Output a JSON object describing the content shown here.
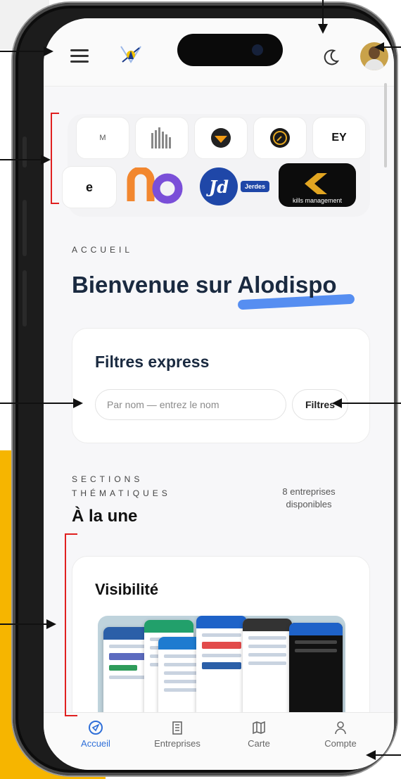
{
  "colors": {
    "accent": "#2f6fd8",
    "annotation_arrow": "#111111",
    "annotation_bracket": "#e02020",
    "highlight": "#f6b500"
  },
  "header": {
    "menu_icon": "hamburger-icon",
    "logo_icon": "app-logo-icon",
    "theme_icon": "moon-icon",
    "avatar_icon": "user-avatar"
  },
  "partners": {
    "row1": [
      "M",
      "",
      "",
      "",
      "EY"
    ],
    "row2": [
      "e",
      "",
      "Jerdes",
      "kills management"
    ],
    "row2_logo_text": "Jd"
  },
  "page": {
    "overline": "ACCUEIL",
    "title_prefix": "Bienvenue sur ",
    "title_brand": "Alodispo"
  },
  "filters": {
    "title": "Filtres express",
    "search_placeholder": "Par nom — entrez le nom",
    "button_label": "Filtres"
  },
  "sections": {
    "overline_1": "SECTIONS",
    "overline_2": "THÉMATIQUES",
    "heading": "À la une",
    "count_label": "8 entreprises disponibles",
    "card_title": "Visibilité"
  },
  "bottom_nav": [
    {
      "label": "Accueil",
      "icon": "compass-icon",
      "active": true
    },
    {
      "label": "Entreprises",
      "icon": "building-icon",
      "active": false
    },
    {
      "label": "Carte",
      "icon": "map-icon",
      "active": false
    },
    {
      "label": "Compte",
      "icon": "user-icon",
      "active": false
    }
  ]
}
